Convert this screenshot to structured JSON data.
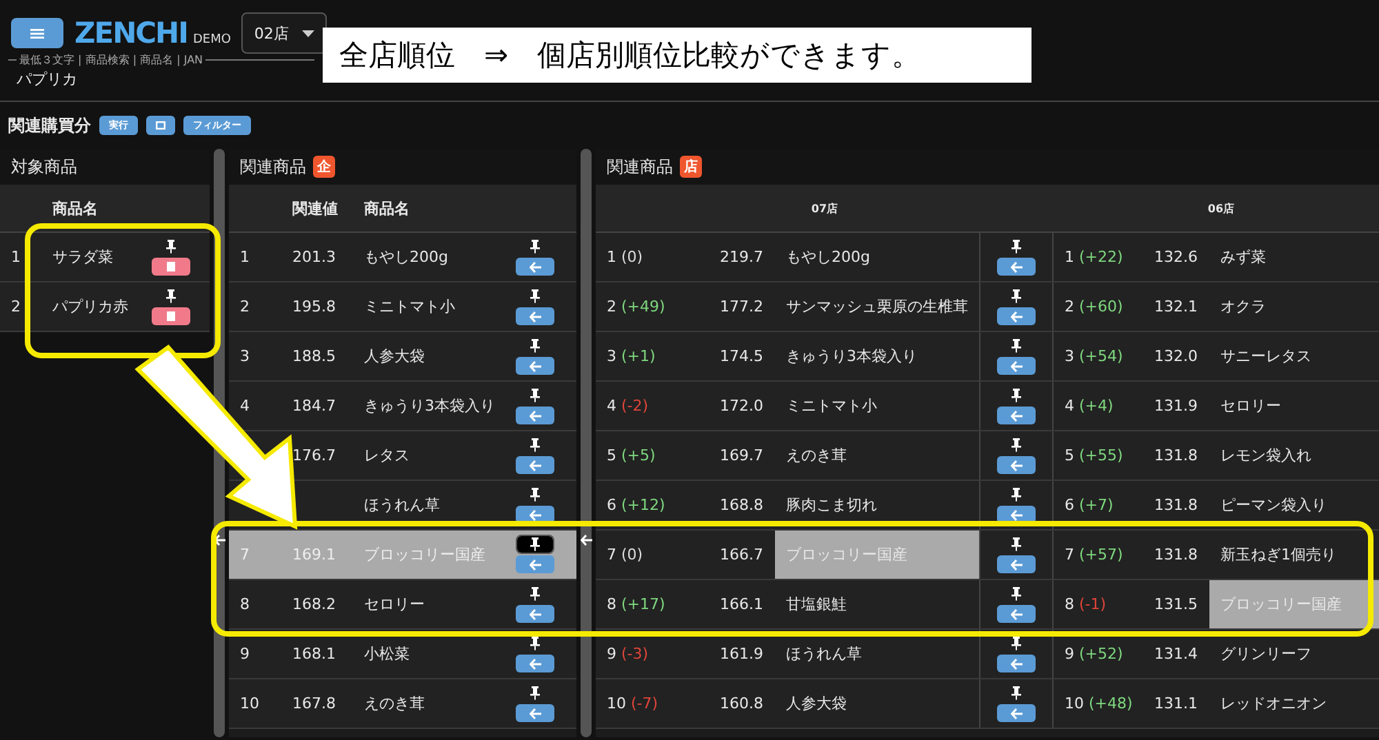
{
  "header": {
    "logo": "ZENCHI",
    "badge": "DEMO",
    "store": "02店"
  },
  "search": {
    "label": "最低３文字 | 商品検索 | 商品名 | JAN",
    "value": "パプリカ"
  },
  "toolbar": {
    "label": "関連購買分",
    "buttons": [
      {
        "kind": "text",
        "label": "実行"
      },
      {
        "kind": "square"
      },
      {
        "kind": "text",
        "label": "フィルター"
      }
    ]
  },
  "target_panel": {
    "title": "対象商品",
    "columns": [
      "商品名"
    ],
    "rows": [
      {
        "rank": "1",
        "name": "サラダ菜"
      },
      {
        "rank": "2",
        "name": "パプリカ赤"
      }
    ]
  },
  "related_panel": {
    "title": "関連商品",
    "badge": "企",
    "columns": [
      "関連値",
      "商品名"
    ],
    "rows": [
      {
        "rank": "1",
        "value": "201.3",
        "name": "もやし200g",
        "selected": false,
        "pinned": false
      },
      {
        "rank": "2",
        "value": "195.8",
        "name": "ミニトマト小",
        "selected": false,
        "pinned": false
      },
      {
        "rank": "3",
        "value": "188.5",
        "name": "人参大袋",
        "selected": false,
        "pinned": false
      },
      {
        "rank": "4",
        "value": "184.7",
        "name": "きゅうり3本袋入り",
        "selected": false,
        "pinned": false
      },
      {
        "value": "176.7",
        "name": "レタス",
        "selected": false,
        "pinned": false
      },
      {
        "name": "ほうれん草",
        "selected": false,
        "pinned": false
      },
      {
        "rank": "7",
        "value": "169.1",
        "name": "ブロッコリー国産",
        "selected": true,
        "pinned": true
      },
      {
        "rank": "8",
        "value": "168.2",
        "name": "セロリー",
        "selected": false,
        "pinned": false
      },
      {
        "rank": "9",
        "value": "168.1",
        "name": "小松菜",
        "selected": false,
        "pinned": false
      },
      {
        "rank": "10",
        "value": "167.8",
        "name": "えのき茸",
        "selected": false,
        "pinned": false
      }
    ]
  },
  "store_panel": {
    "title": "関連商品",
    "badge": "店",
    "stores": [
      {
        "name": "07店",
        "actions": true,
        "rows": [
          {
            "rank": "1",
            "change": "(0)",
            "color": "#dddddd",
            "value": "219.7",
            "name": "もやし200g",
            "selected": false
          },
          {
            "rank": "2",
            "change": "(+49)",
            "color": "#7fd87f",
            "value": "177.2",
            "name": "サンマッシュ栗原の生椎茸",
            "selected": false
          },
          {
            "rank": "3",
            "change": "(+1)",
            "color": "#7fd87f",
            "value": "174.5",
            "name": "きゅうり3本袋入り",
            "selected": false
          },
          {
            "rank": "4",
            "change": "(-2)",
            "color": "#e0453a",
            "value": "172.0",
            "name": "ミニトマト小",
            "selected": false
          },
          {
            "rank": "5",
            "change": "(+5)",
            "color": "#7fd87f",
            "value": "169.7",
            "name": "えのき茸",
            "selected": false
          },
          {
            "rank": "6",
            "change": "(+12)",
            "color": "#7fd87f",
            "value": "168.8",
            "name": "豚肉こま切れ",
            "selected": false
          },
          {
            "rank": "7",
            "change": "(0)",
            "color": "#dddddd",
            "value": "166.7",
            "name": "ブロッコリー国産",
            "selected": true
          },
          {
            "rank": "8",
            "change": "(+17)",
            "color": "#7fd87f",
            "value": "166.1",
            "name": "甘塩銀鮭",
            "selected": false
          },
          {
            "rank": "9",
            "change": "(-3)",
            "color": "#e0453a",
            "value": "161.9",
            "name": "ほうれん草",
            "selected": false
          },
          {
            "rank": "10",
            "change": "(-7)",
            "color": "#e0453a",
            "value": "160.8",
            "name": "人参大袋",
            "selected": false
          }
        ]
      },
      {
        "name": "06店",
        "actions": false,
        "rows": [
          {
            "rank": "1",
            "change": "(+22)",
            "color": "#7fd87f",
            "value": "132.6",
            "name": "みず菜",
            "selected": false
          },
          {
            "rank": "2",
            "change": "(+60)",
            "color": "#7fd87f",
            "value": "132.1",
            "name": "オクラ",
            "selected": false
          },
          {
            "rank": "3",
            "change": "(+54)",
            "color": "#7fd87f",
            "value": "132.0",
            "name": "サニーレタス",
            "selected": false
          },
          {
            "rank": "4",
            "change": "(+4)",
            "color": "#7fd87f",
            "value": "131.9",
            "name": "セロリー",
            "selected": false
          },
          {
            "rank": "5",
            "change": "(+55)",
            "color": "#7fd87f",
            "value": "131.8",
            "name": "レモン袋入れ",
            "selected": false
          },
          {
            "rank": "6",
            "change": "(+7)",
            "color": "#7fd87f",
            "value": "131.8",
            "name": "ピーマン袋入り",
            "selected": false
          },
          {
            "rank": "7",
            "change": "(+57)",
            "color": "#7fd87f",
            "value": "131.8",
            "name": "新玉ねぎ1個売り",
            "selected": false
          },
          {
            "rank": "8",
            "change": "(-1)",
            "color": "#e0453a",
            "value": "131.5",
            "name": "ブロッコリー国産",
            "selected": true
          },
          {
            "rank": "9",
            "change": "(+52)",
            "color": "#7fd87f",
            "value": "131.4",
            "name": "グリンリーフ",
            "selected": false
          },
          {
            "rank": "10",
            "change": "(+48)",
            "color": "#7fd87f",
            "value": "131.1",
            "name": "レッドオニオン",
            "selected": false
          }
        ]
      }
    ]
  },
  "annotation": {
    "text": "全店順位　⇒　個店別順位比較ができます。"
  }
}
